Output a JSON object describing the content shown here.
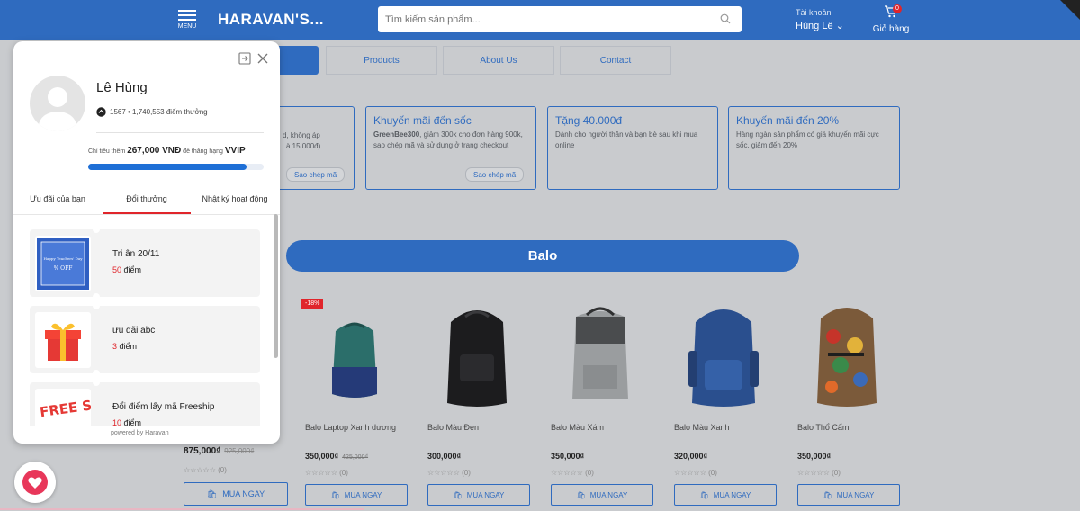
{
  "header": {
    "menu_label": "MENU",
    "brand": "HARAVAN'S...",
    "search_placeholder": "Tìm kiếm sản phẩm...",
    "account_label": "Tài khoản",
    "account_name": "Hùng Lê ⌄",
    "cart_label": "Giỏ hàng",
    "cart_count": "0"
  },
  "nav": {
    "tabs": [
      "Products",
      "About Us",
      "​Contact"
    ]
  },
  "promos": {
    "partial_lines": [
      "d, không áp",
      "à 15.000đ)"
    ],
    "partial_btn": "Sao chép mã",
    "cards": [
      {
        "title": "Khuyến mãi đến sốc",
        "code": "GreenBee300",
        "desc": ", giảm 300k cho đơn hàng 900k, sao chép mã và sử dụng ở trang checkout",
        "btn": "Sao chép mã"
      },
      {
        "title": "Tặng 40.000đ",
        "desc": "Dành cho người thân và bạn bè sau khi mua online"
      },
      {
        "title": "Khuyến mãi đến 20%",
        "desc": "Hàng ngàn sản phẩm có giá khuyến mãi cực sốc, giảm đến 20%"
      }
    ]
  },
  "section": {
    "title": "Balo"
  },
  "left_product": {
    "price": "875,000₫",
    "old_price": "925,000₫",
    "rating": "☆☆☆☆☆ (0)",
    "buy": "MUA NGAY"
  },
  "products": [
    {
      "name": "Balo Laptop Xanh dương",
      "price": "350,000₫",
      "old_price": "425,000₫",
      "badge": "-18%",
      "rating": "☆☆☆☆☆ (0)",
      "buy": "MUA NGAY",
      "color": "#2b6e6a"
    },
    {
      "name": "Balo Màu Đen",
      "price": "300,000₫",
      "rating": "☆☆☆☆☆ (0)",
      "buy": "MUA NGAY",
      "color": "#1c1c1e"
    },
    {
      "name": "Balo Màu Xám",
      "price": "350,000₫",
      "rating": "☆☆☆☆☆ (0)",
      "buy": "MUA NGAY",
      "color": "#8e9193"
    },
    {
      "name": "Balo Màu Xanh",
      "price": "320,000₫",
      "rating": "☆☆☆☆☆ (0)",
      "buy": "MUA NGAY",
      "color": "#2a4f8e"
    },
    {
      "name": "Balo Thổ Cẩm",
      "price": "350,000₫",
      "rating": "☆☆☆☆☆ (0)",
      "buy": "MUA NGAY",
      "color": "#6a4a2a"
    }
  ],
  "panel": {
    "user_name": "Lê Hùng",
    "points_text": "1567 • 1,740,553 điểm thưởng",
    "target_prefix": "Chỉ tiêu thêm ",
    "target_amount": "267,000 VNĐ",
    "target_mid": " để thăng hạng ",
    "target_tier": "VVIP",
    "progress": 0.9,
    "tabs": [
      "Ưu đãi của bạn",
      "Đổi thưởng",
      "Nhật ký hoạt động"
    ],
    "rewards": [
      {
        "name": "Tri ân 20/11",
        "points": "50",
        "unit": " điểm"
      },
      {
        "name": "ưu đãi abc",
        "points": "3",
        "unit": " điểm"
      },
      {
        "name": "Đổi điểm lấy mã Freeship",
        "points": "10",
        "unit": " điểm"
      }
    ],
    "thumb_texts": [
      "Happy Teachers' Day",
      "% OFF",
      "FREE SHIPPING"
    ],
    "powered": "powered by Haravan"
  },
  "colors": {
    "brand_blue": "#2f6bbf",
    "accent_red": "#e0252b"
  }
}
